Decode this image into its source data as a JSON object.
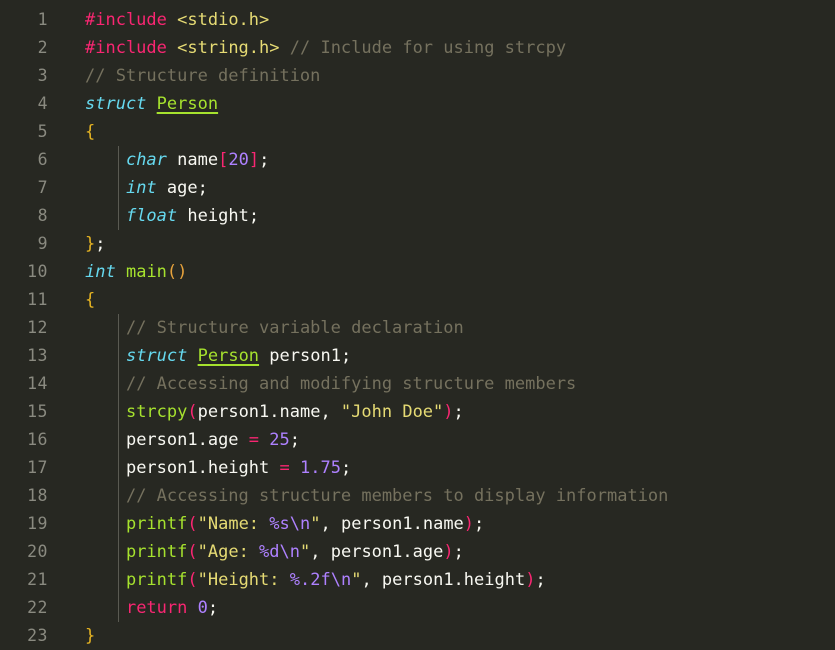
{
  "editor": {
    "background": "#272822",
    "line_number_color": "#8a8a80",
    "indent_guide_color": "#5a5a52",
    "language": "c",
    "first_line": 1,
    "last_line": 23,
    "total_lines": 23
  },
  "palette": {
    "preprocessor": "#F92672",
    "keyword": "#F92672",
    "type": "#66D9EF",
    "entity": "#A6E22E",
    "function": "#A6E22E",
    "string": "#E6DB74",
    "number": "#AE81FF",
    "escape": "#AE81FF",
    "comment": "#75715E",
    "plain": "#F8F8F2",
    "paren": "#F92672",
    "brace": "#E6B422"
  },
  "indent_guides": [
    {
      "line_start": 6,
      "line_end": 8,
      "column": 4
    },
    {
      "line_start": 12,
      "line_end": 22,
      "column": 4
    }
  ],
  "lines": [
    {
      "number": "1",
      "text": "#include <stdio.h>",
      "tokens": [
        {
          "t": "#include",
          "c": "t-pre"
        },
        {
          "t": " ",
          "c": "t-plain"
        },
        {
          "t": "<stdio.h>",
          "c": "t-string"
        }
      ]
    },
    {
      "number": "2",
      "text": "#include <string.h> // Include for using strcpy",
      "tokens": [
        {
          "t": "#include",
          "c": "t-pre"
        },
        {
          "t": " ",
          "c": "t-plain"
        },
        {
          "t": "<string.h>",
          "c": "t-string"
        },
        {
          "t": " ",
          "c": "t-plain"
        },
        {
          "t": "// Include for using strcpy",
          "c": "t-comment"
        }
      ]
    },
    {
      "number": "3",
      "text": "// Structure definition",
      "tokens": [
        {
          "t": "// Structure definition",
          "c": "t-comment"
        }
      ]
    },
    {
      "number": "4",
      "text": "struct Person",
      "tokens": [
        {
          "t": "struct",
          "c": "t-type"
        },
        {
          "t": " ",
          "c": "t-plain"
        },
        {
          "t": "Person",
          "c": "t-entity-u"
        }
      ]
    },
    {
      "number": "5",
      "text": "{",
      "tokens": [
        {
          "t": "{",
          "c": "t-brace"
        }
      ]
    },
    {
      "number": "6",
      "text": "    char name[20];",
      "tokens": [
        {
          "t": "    ",
          "c": "t-plain"
        },
        {
          "t": "char",
          "c": "t-type"
        },
        {
          "t": " ",
          "c": "t-plain"
        },
        {
          "t": "name",
          "c": "t-plain"
        },
        {
          "t": "[",
          "c": "t-bracket"
        },
        {
          "t": "20",
          "c": "t-number"
        },
        {
          "t": "]",
          "c": "t-bracket"
        },
        {
          "t": ";",
          "c": "t-punct"
        }
      ]
    },
    {
      "number": "7",
      "text": "    int age;",
      "tokens": [
        {
          "t": "    ",
          "c": "t-plain"
        },
        {
          "t": "int",
          "c": "t-type"
        },
        {
          "t": " ",
          "c": "t-plain"
        },
        {
          "t": "age",
          "c": "t-plain"
        },
        {
          "t": ";",
          "c": "t-punct"
        }
      ]
    },
    {
      "number": "8",
      "text": "    float height;",
      "tokens": [
        {
          "t": "    ",
          "c": "t-plain"
        },
        {
          "t": "float",
          "c": "t-type"
        },
        {
          "t": " ",
          "c": "t-plain"
        },
        {
          "t": "height",
          "c": "t-plain"
        },
        {
          "t": ";",
          "c": "t-punct"
        }
      ]
    },
    {
      "number": "9",
      "text": "};",
      "tokens": [
        {
          "t": "}",
          "c": "t-brace"
        },
        {
          "t": ";",
          "c": "t-punct"
        }
      ]
    },
    {
      "number": "10",
      "text": "int main()",
      "tokens": [
        {
          "t": "int",
          "c": "t-type"
        },
        {
          "t": " ",
          "c": "t-plain"
        },
        {
          "t": "main",
          "c": "t-func"
        },
        {
          "t": "()",
          "c": "t-paren-y"
        }
      ]
    },
    {
      "number": "11",
      "text": "{",
      "tokens": [
        {
          "t": "{",
          "c": "t-brace"
        }
      ]
    },
    {
      "number": "12",
      "text": "    // Structure variable declaration",
      "tokens": [
        {
          "t": "    ",
          "c": "t-plain"
        },
        {
          "t": "// Structure variable declaration",
          "c": "t-comment"
        }
      ]
    },
    {
      "number": "13",
      "text": "    struct Person person1;",
      "tokens": [
        {
          "t": "    ",
          "c": "t-plain"
        },
        {
          "t": "struct",
          "c": "t-type"
        },
        {
          "t": " ",
          "c": "t-plain"
        },
        {
          "t": "Person",
          "c": "t-entity-u"
        },
        {
          "t": " ",
          "c": "t-plain"
        },
        {
          "t": "person1",
          "c": "t-plain"
        },
        {
          "t": ";",
          "c": "t-punct"
        }
      ]
    },
    {
      "number": "14",
      "text": "    // Accessing and modifying structure members",
      "tokens": [
        {
          "t": "    ",
          "c": "t-plain"
        },
        {
          "t": "// Accessing and modifying structure members",
          "c": "t-comment"
        }
      ]
    },
    {
      "number": "15",
      "text": "    strcpy(person1.name, \"John Doe\");",
      "tokens": [
        {
          "t": "    ",
          "c": "t-plain"
        },
        {
          "t": "strcpy",
          "c": "t-func"
        },
        {
          "t": "(",
          "c": "t-paren"
        },
        {
          "t": "person1.name, ",
          "c": "t-plain"
        },
        {
          "t": "\"John Doe\"",
          "c": "t-string"
        },
        {
          "t": ")",
          "c": "t-paren"
        },
        {
          "t": ";",
          "c": "t-punct"
        }
      ]
    },
    {
      "number": "16",
      "text": "    person1.age = 25;",
      "tokens": [
        {
          "t": "    ",
          "c": "t-plain"
        },
        {
          "t": "person1.age ",
          "c": "t-plain"
        },
        {
          "t": "=",
          "c": "t-op"
        },
        {
          "t": " ",
          "c": "t-plain"
        },
        {
          "t": "25",
          "c": "t-number"
        },
        {
          "t": ";",
          "c": "t-punct"
        }
      ]
    },
    {
      "number": "17",
      "text": "    person1.height = 1.75;",
      "tokens": [
        {
          "t": "    ",
          "c": "t-plain"
        },
        {
          "t": "person1.height ",
          "c": "t-plain"
        },
        {
          "t": "=",
          "c": "t-op"
        },
        {
          "t": " ",
          "c": "t-plain"
        },
        {
          "t": "1.75",
          "c": "t-number"
        },
        {
          "t": ";",
          "c": "t-punct"
        }
      ]
    },
    {
      "number": "18",
      "text": "    // Accessing structure members to display information",
      "tokens": [
        {
          "t": "    ",
          "c": "t-plain"
        },
        {
          "t": "// Accessing structure members to display information",
          "c": "t-comment"
        }
      ]
    },
    {
      "number": "19",
      "text": "    printf(\"Name: %s\\n\", person1.name);",
      "tokens": [
        {
          "t": "    ",
          "c": "t-plain"
        },
        {
          "t": "printf",
          "c": "t-func"
        },
        {
          "t": "(",
          "c": "t-paren"
        },
        {
          "t": "\"Name: ",
          "c": "t-string"
        },
        {
          "t": "%s",
          "c": "t-escape"
        },
        {
          "t": "\\n",
          "c": "t-escape"
        },
        {
          "t": "\"",
          "c": "t-string"
        },
        {
          "t": ", person1.name",
          "c": "t-plain"
        },
        {
          "t": ")",
          "c": "t-paren"
        },
        {
          "t": ";",
          "c": "t-punct"
        }
      ]
    },
    {
      "number": "20",
      "text": "    printf(\"Age: %d\\n\", person1.age);",
      "tokens": [
        {
          "t": "    ",
          "c": "t-plain"
        },
        {
          "t": "printf",
          "c": "t-func"
        },
        {
          "t": "(",
          "c": "t-paren"
        },
        {
          "t": "\"Age: ",
          "c": "t-string"
        },
        {
          "t": "%d",
          "c": "t-escape"
        },
        {
          "t": "\\n",
          "c": "t-escape"
        },
        {
          "t": "\"",
          "c": "t-string"
        },
        {
          "t": ", person1.age",
          "c": "t-plain"
        },
        {
          "t": ")",
          "c": "t-paren"
        },
        {
          "t": ";",
          "c": "t-punct"
        }
      ]
    },
    {
      "number": "21",
      "text": "    printf(\"Height: %.2f\\n\", person1.height);",
      "tokens": [
        {
          "t": "    ",
          "c": "t-plain"
        },
        {
          "t": "printf",
          "c": "t-func"
        },
        {
          "t": "(",
          "c": "t-paren"
        },
        {
          "t": "\"Height: ",
          "c": "t-string"
        },
        {
          "t": "%.2f",
          "c": "t-escape"
        },
        {
          "t": "\\n",
          "c": "t-escape"
        },
        {
          "t": "\"",
          "c": "t-string"
        },
        {
          "t": ", person1.height",
          "c": "t-plain"
        },
        {
          "t": ")",
          "c": "t-paren"
        },
        {
          "t": ";",
          "c": "t-punct"
        }
      ]
    },
    {
      "number": "22",
      "text": "    return 0;",
      "tokens": [
        {
          "t": "    ",
          "c": "t-plain"
        },
        {
          "t": "return",
          "c": "t-keyword"
        },
        {
          "t": " ",
          "c": "t-plain"
        },
        {
          "t": "0",
          "c": "t-number"
        },
        {
          "t": ";",
          "c": "t-punct"
        }
      ]
    },
    {
      "number": "23",
      "text": "}",
      "tokens": [
        {
          "t": "}",
          "c": "t-brace"
        }
      ]
    }
  ]
}
